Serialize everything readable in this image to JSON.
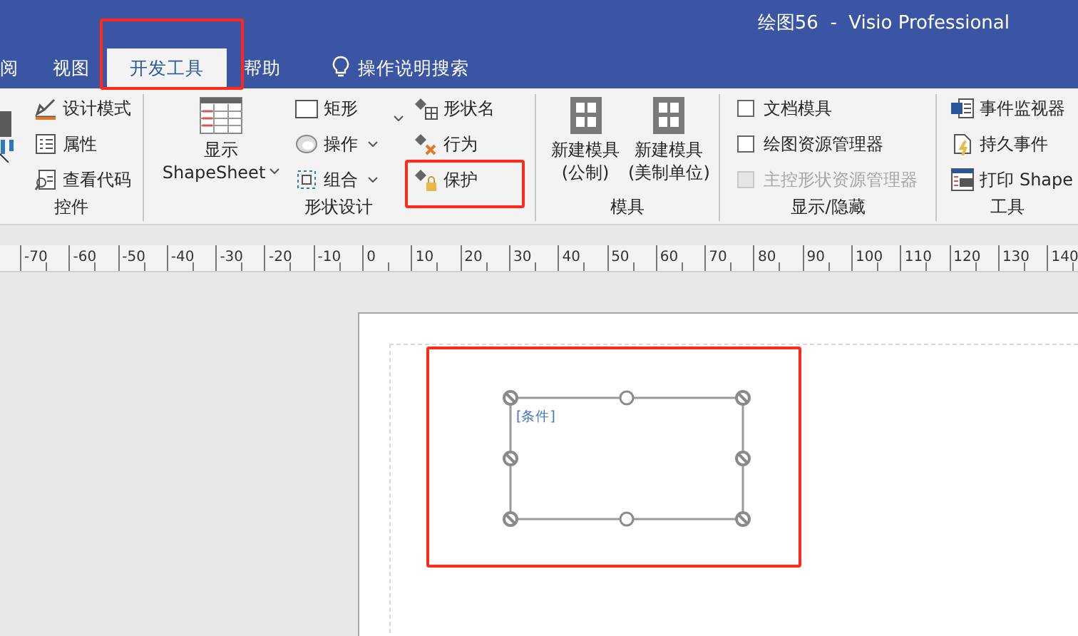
{
  "window": {
    "title": "绘图56  -  Visio Professional"
  },
  "tabs": [
    {
      "label": "阅",
      "selected": false
    },
    {
      "label": "视图",
      "selected": false
    },
    {
      "label": "开发工具",
      "selected": true
    },
    {
      "label": "帮助",
      "selected": false
    }
  ],
  "search": {
    "placeholder": "操作说明搜索"
  },
  "ribbon": {
    "controls": {
      "label": "控件",
      "items": [
        {
          "label": "设计模式"
        },
        {
          "label": "属性"
        },
        {
          "label": "查看代码"
        }
      ]
    },
    "shape_design": {
      "label": "形状设计",
      "big_button": {
        "line1": "显示",
        "line2": "ShapeSheet"
      },
      "column_1": [
        {
          "label": "矩形",
          "dropdown": false
        },
        {
          "label": "操作",
          "dropdown": true
        },
        {
          "label": "组合",
          "dropdown": true
        }
      ],
      "column_2": [
        {
          "label": "形状名"
        },
        {
          "label": "行为"
        },
        {
          "label": "保护"
        }
      ]
    },
    "stencil": {
      "label": "模具",
      "buttons": [
        {
          "line1": "新建模具",
          "line2": "(公制)"
        },
        {
          "line1": "新建模具",
          "line2": "(美制单位)"
        }
      ]
    },
    "show_hide": {
      "label": "显示/隐藏",
      "checkboxes": [
        {
          "label": "文档模具",
          "checked": false,
          "disabled": false
        },
        {
          "label": "绘图资源管理器",
          "checked": false,
          "disabled": false
        },
        {
          "label": "主控形状资源管理器",
          "checked": false,
          "disabled": true
        }
      ]
    },
    "tools": {
      "label": "工具",
      "items": [
        {
          "label": "事件监视器"
        },
        {
          "label": "持久事件"
        },
        {
          "label": "打印 Shape"
        }
      ]
    }
  },
  "ruler": {
    "labels": [
      "-70",
      "-60",
      "-50",
      "-40",
      "-30",
      "-20",
      "-10",
      "0",
      "10",
      "20",
      "30",
      "40",
      "50",
      "60",
      "70",
      "80",
      "90",
      "100",
      "110",
      "120",
      "130",
      "140"
    ]
  },
  "shape": {
    "text": "[条件]"
  }
}
